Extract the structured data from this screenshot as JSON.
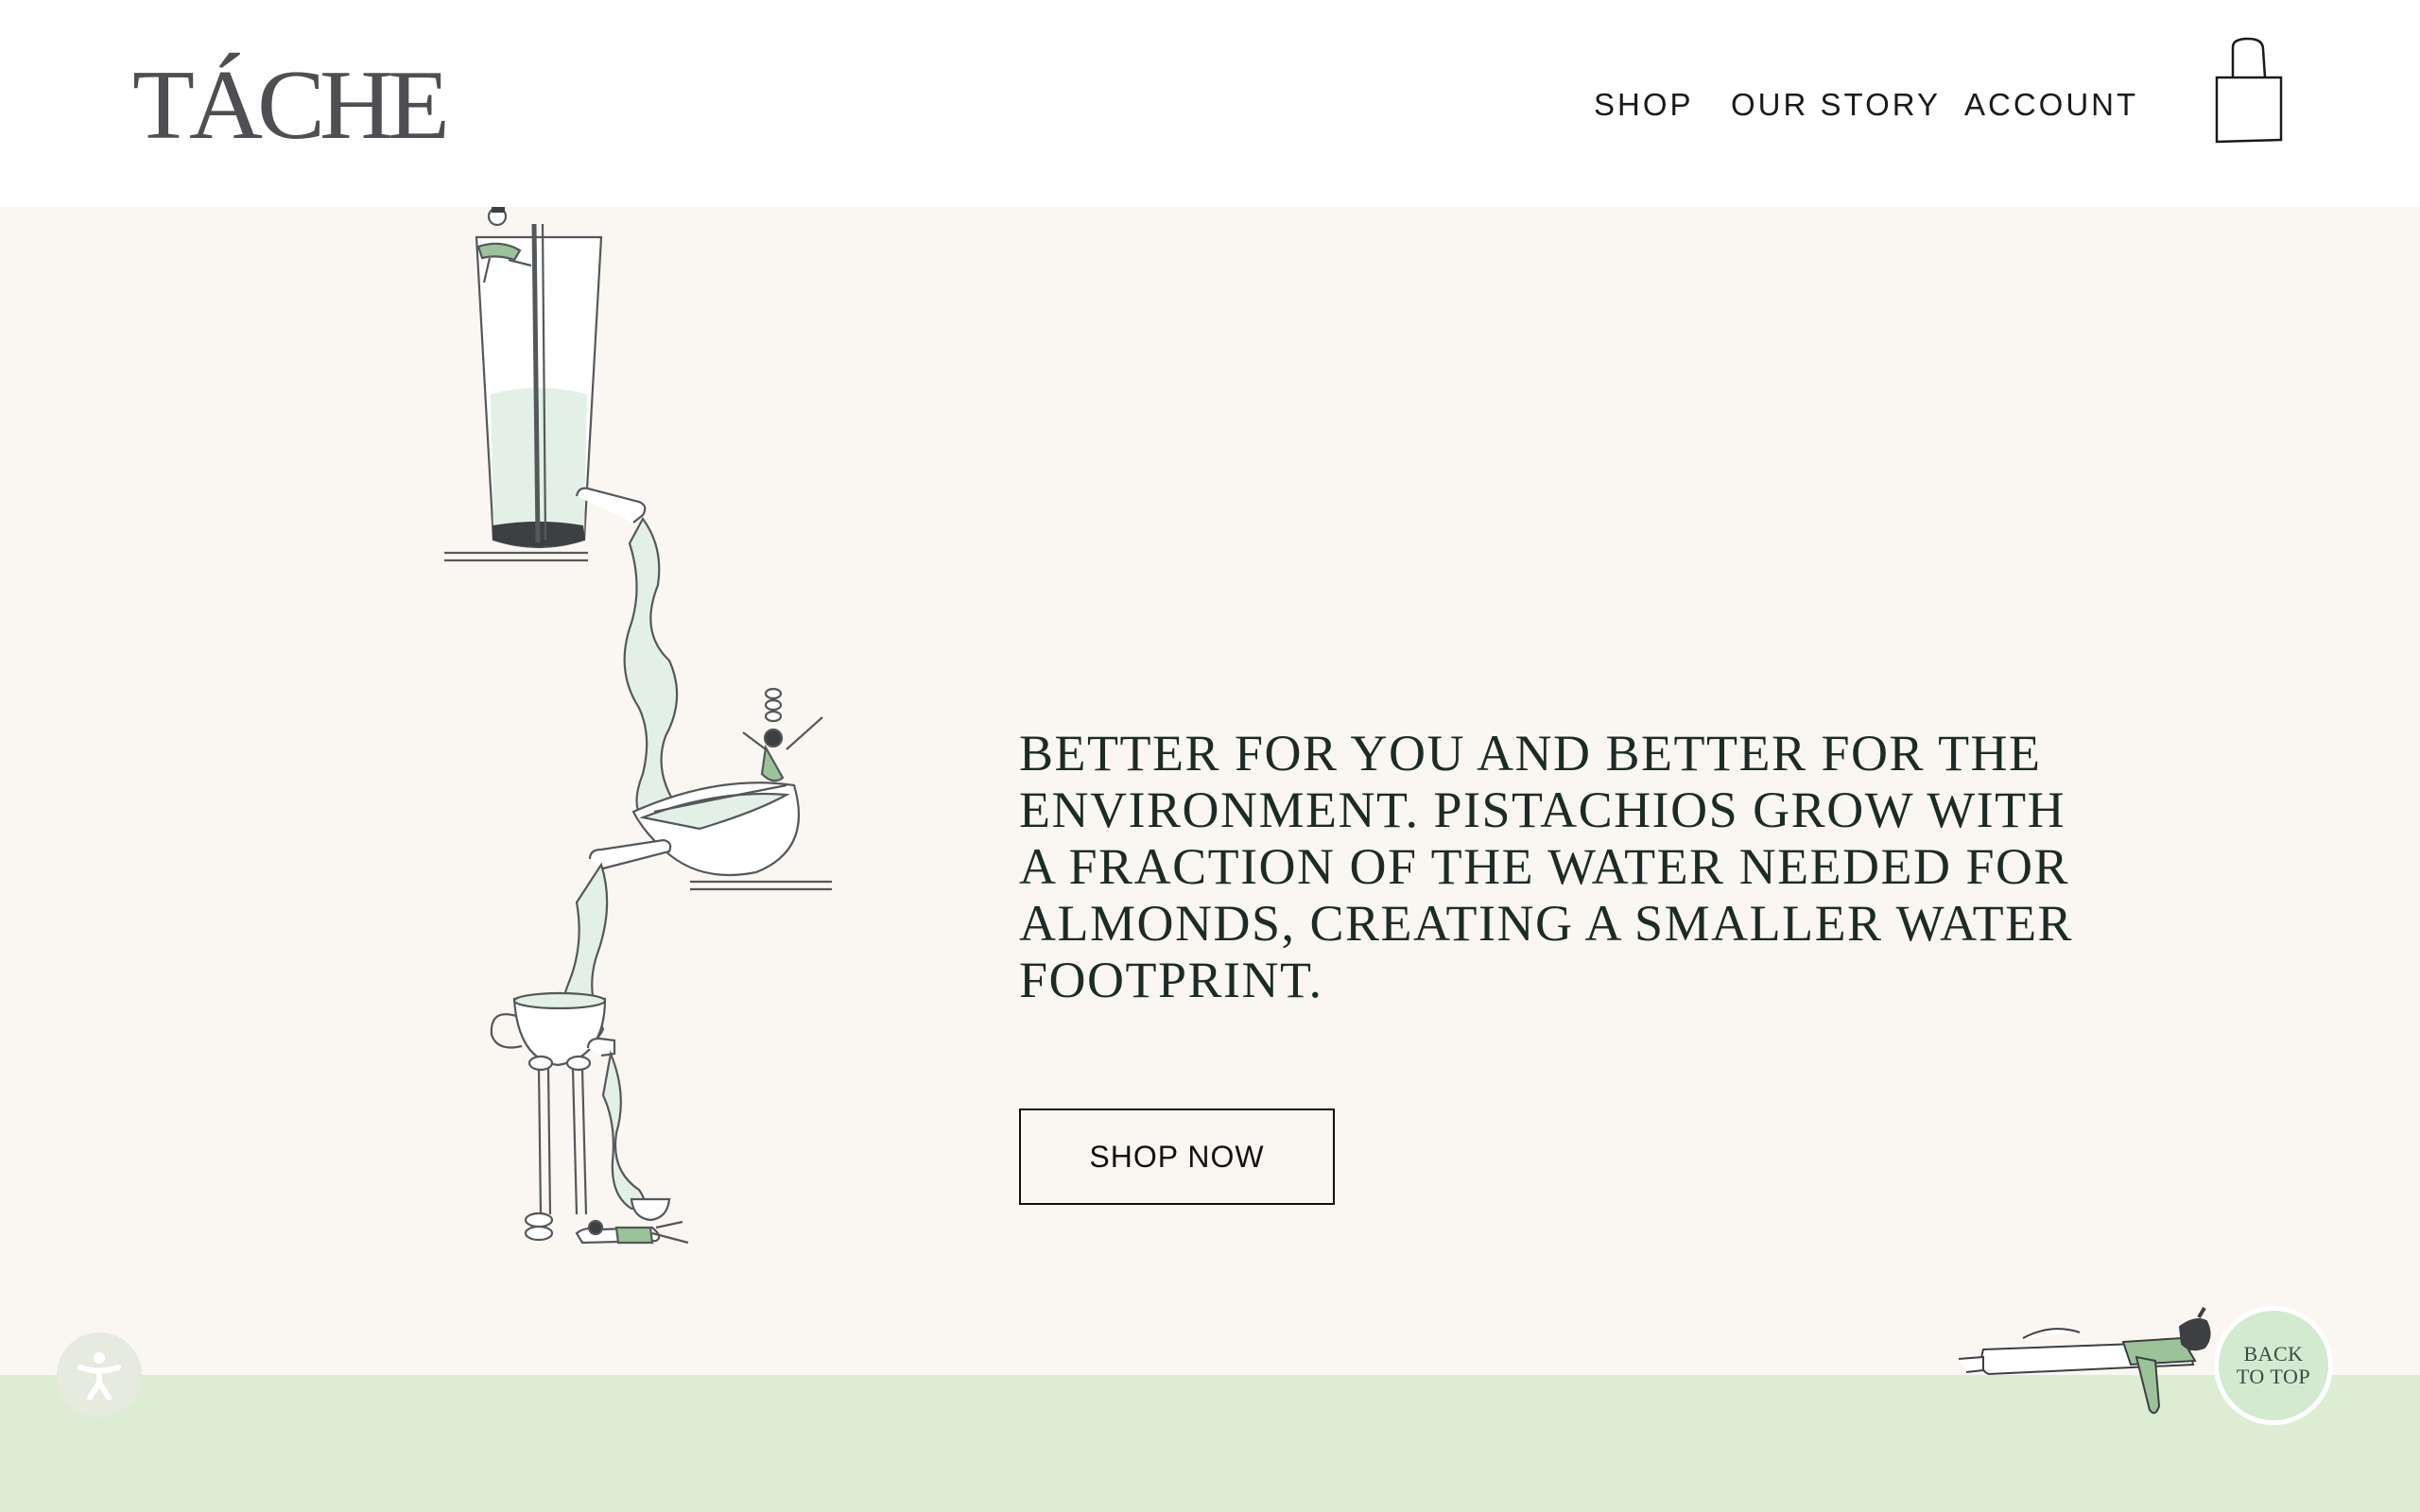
{
  "brand": {
    "logo": "TÁCHE"
  },
  "nav": {
    "items": [
      "SHOP",
      "OUR STORY",
      "ACCOUNT"
    ],
    "cart_icon": "shopping-bag-icon"
  },
  "hero": {
    "headline": "BETTER FOR YOU AND BETTER FOR THE ENVIRONMENT. PISTACHIOS GROW WITH A FRACTION OF THE WATER NEEDED FOR ALMONDS, CREATING A SMALLER WATER FOOTPRINT.",
    "cta": "SHOP NOW",
    "illustration": "pouring-milk-illustration"
  },
  "back_to_top": {
    "line1": "BACK",
    "line2": "TO TOP"
  },
  "accessibility": {
    "icon": "accessibility-icon"
  },
  "colors": {
    "header_bg": "#ffffff",
    "hero_bg": "#faf7f2",
    "footer_band": "#dcedd3",
    "milk": "#e3f0e8",
    "figure_green": "#9cc29a",
    "ink": "#1d2b26",
    "logo": "#4d4f52"
  }
}
